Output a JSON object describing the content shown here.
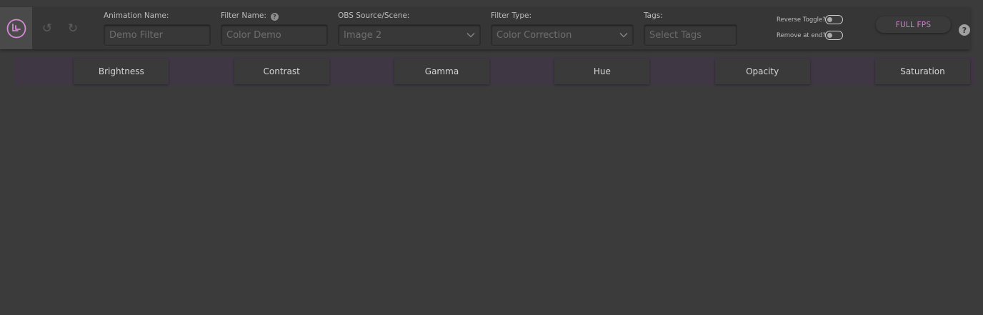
{
  "toolbar": {
    "undo_icon": "↺",
    "redo_icon": "↻",
    "animation_name": {
      "label": "Animation Name:",
      "value": "Demo Filter"
    },
    "filter_name": {
      "label": "Filter Name:",
      "help": "?",
      "value": "Color Demo"
    },
    "obs_source": {
      "label": "OBS Source/Scene:",
      "value": "Image 2"
    },
    "filter_type": {
      "label": "Filter Type:",
      "value": "Color Correction"
    },
    "tags": {
      "label": "Tags:",
      "placeholder": "Select Tags"
    },
    "reverse_toggle": {
      "label": "Reverse Toggle?"
    },
    "remove_at_end": {
      "label": "Remove at end?"
    },
    "fps_button": "FULL FPS",
    "help_button": "?"
  },
  "properties": [
    {
      "label": "Brightness"
    },
    {
      "label": "Contrast"
    },
    {
      "label": "Gamma"
    },
    {
      "label": "Hue"
    },
    {
      "label": "Opacity"
    },
    {
      "label": "Saturation"
    }
  ],
  "colors": {
    "accent": "#d47fd4",
    "background": "#3b3b3b",
    "toolbar": "#363636"
  }
}
